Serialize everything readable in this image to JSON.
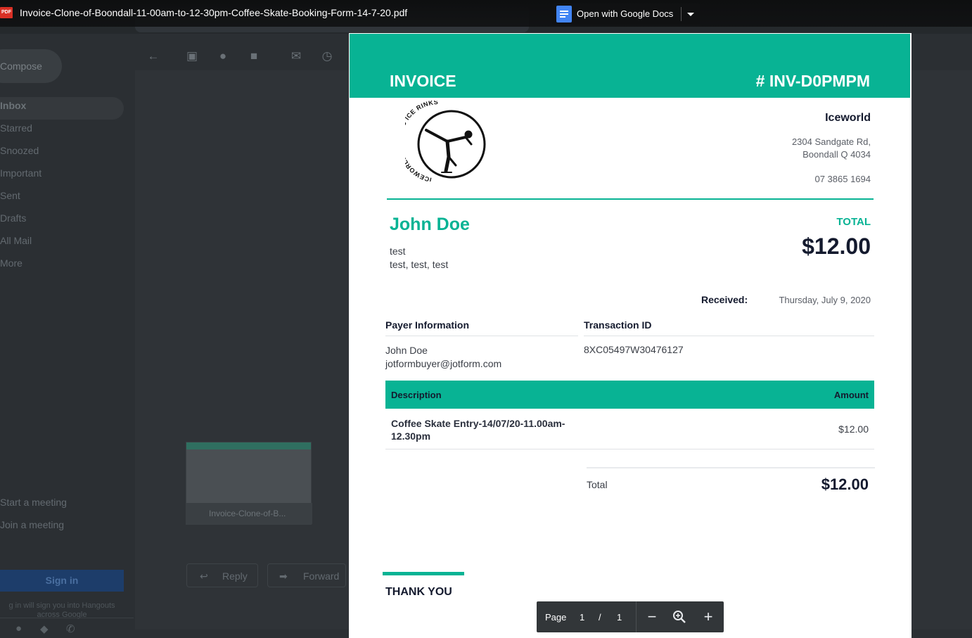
{
  "viewer": {
    "file_icon_label": "PDF",
    "file_name": "Invoice-Clone-of-Boondall-11-00am-to-12-30pm-Coffee-Skate-Booking-Form-14-7-20.pdf",
    "open_with_label": "Open with Google Docs",
    "page_label": "Page",
    "page_current": "1",
    "page_separator": "/",
    "page_total": "1"
  },
  "gmail": {
    "compose_label": "Compose",
    "nav_items": [
      "Inbox",
      "Starred",
      "Snoozed",
      "Important",
      "Sent",
      "Drafts",
      "All Mail",
      "More"
    ],
    "meet_items": [
      "Start a meeting",
      "Join a meeting"
    ],
    "sign_in_label": "Sign in",
    "hangouts_note": "g in will sign you into Hangouts across Google",
    "attachment_name": "Invoice-Clone-of-B...",
    "reply_label": "Reply",
    "forward_label": "Forward"
  },
  "invoice": {
    "title": "INVOICE",
    "number": "# INV-D0PMPM",
    "logo_text": "ICEWORLD OLYMPIC ICE RINKS",
    "company_name": "Iceworld",
    "address_line1": "2304 Sandgate Rd,",
    "address_line2": "Boondall Q 4034",
    "phone": "07 3865 1694",
    "customer_name": "John Doe",
    "customer_line1": "test",
    "customer_line2": "test, test, test",
    "total_label": "TOTAL",
    "total_value": "$12.00",
    "received_label": "Received:",
    "received_date": "Thursday, July 9, 2020",
    "payer_heading": "Payer Information",
    "payer_name": "John Doe",
    "payer_email": "jotformbuyer@jotform.com",
    "txn_heading": "Transaction ID",
    "txn_id": "8XC05497W30476127",
    "col_description": "Description",
    "col_amount": "Amount",
    "item_description": "Coffee Skate Entry-14/07/20-11.00am-12.30pm",
    "item_amount": "$12.00",
    "summary_label": "Total",
    "summary_value": "$12.00",
    "thank_you": "THANK YOU"
  },
  "colors": {
    "accent": "#08b394",
    "dark_text": "#141a2e"
  }
}
